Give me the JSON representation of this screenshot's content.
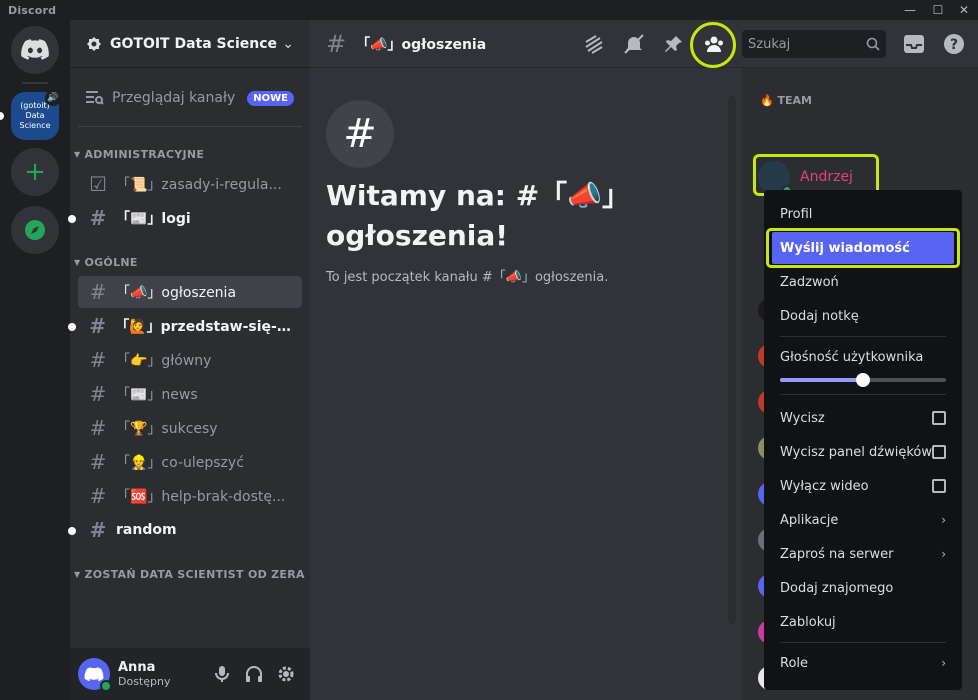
{
  "app": {
    "title": "Discord"
  },
  "window": {
    "minimize": "—",
    "maximize": "☐",
    "close": "✕"
  },
  "rail": {
    "server_label": "(gotoit) Data Science",
    "add_icon": "plus-icon",
    "explore_icon": "compass-icon"
  },
  "server": {
    "name": "GOTOIT Data Science"
  },
  "sidebar": {
    "browse_label": "Przeglądaj kanały",
    "browse_badge": "NOWE",
    "categories": [
      {
        "name": "ADMINISTRACYJNE"
      },
      {
        "name": "OGÓLNE"
      },
      {
        "name": "ZOSTAŃ DATA SCIENTIST OD ZERA"
      }
    ],
    "channels": [
      {
        "label": "「📜」zasady-i-regula...",
        "state": "normal",
        "icon": "rules-icon"
      },
      {
        "label": "「📰」logi",
        "state": "unread"
      },
      {
        "label": "「📣」ogłoszenia",
        "state": "active"
      },
      {
        "label": "「🙋」przedstaw-się-t...",
        "state": "unread"
      },
      {
        "label": "「👉」główny",
        "state": "normal"
      },
      {
        "label": "「📰」news",
        "state": "normal"
      },
      {
        "label": "「🏆」sukcesy",
        "state": "normal"
      },
      {
        "label": "「👷」co-ulepszyć",
        "state": "normal"
      },
      {
        "label": "「🆘」help-brak-dostę...",
        "state": "normal"
      },
      {
        "label": "random",
        "state": "unread"
      }
    ]
  },
  "user_panel": {
    "name": "Anna",
    "status": "Dostępny"
  },
  "header": {
    "channel": "「📣」ogłoszenia",
    "search_placeholder": "Szukaj"
  },
  "welcome": {
    "title": "Witamy na: #「📣」ogłoszenia!",
    "subtitle": "To jest początek kanału #「📣」ogłoszenia."
  },
  "members": {
    "role": "🔥 TEAM",
    "highlighted_member": "Andrzej"
  },
  "context_menu": {
    "profile": "Profil",
    "send_message": "Wyślij wiadomość",
    "call": "Zadzwoń",
    "add_note": "Dodaj notkę",
    "volume_label": "Głośność użytkownika",
    "volume_level": 0.5,
    "mute": "Wycisz",
    "mute_soundboard": "Wycisz panel dźwięków",
    "disable_video": "Wyłącz wideo",
    "apps": "Aplikacje",
    "invite": "Zaproś na serwer",
    "add_friend": "Dodaj znajomego",
    "block": "Zablokuj",
    "role": "Role"
  },
  "colors": {
    "accent": "#5865f2",
    "highlight": "#c6e80e",
    "member_name": "#e0466a",
    "online": "#23a55a"
  }
}
